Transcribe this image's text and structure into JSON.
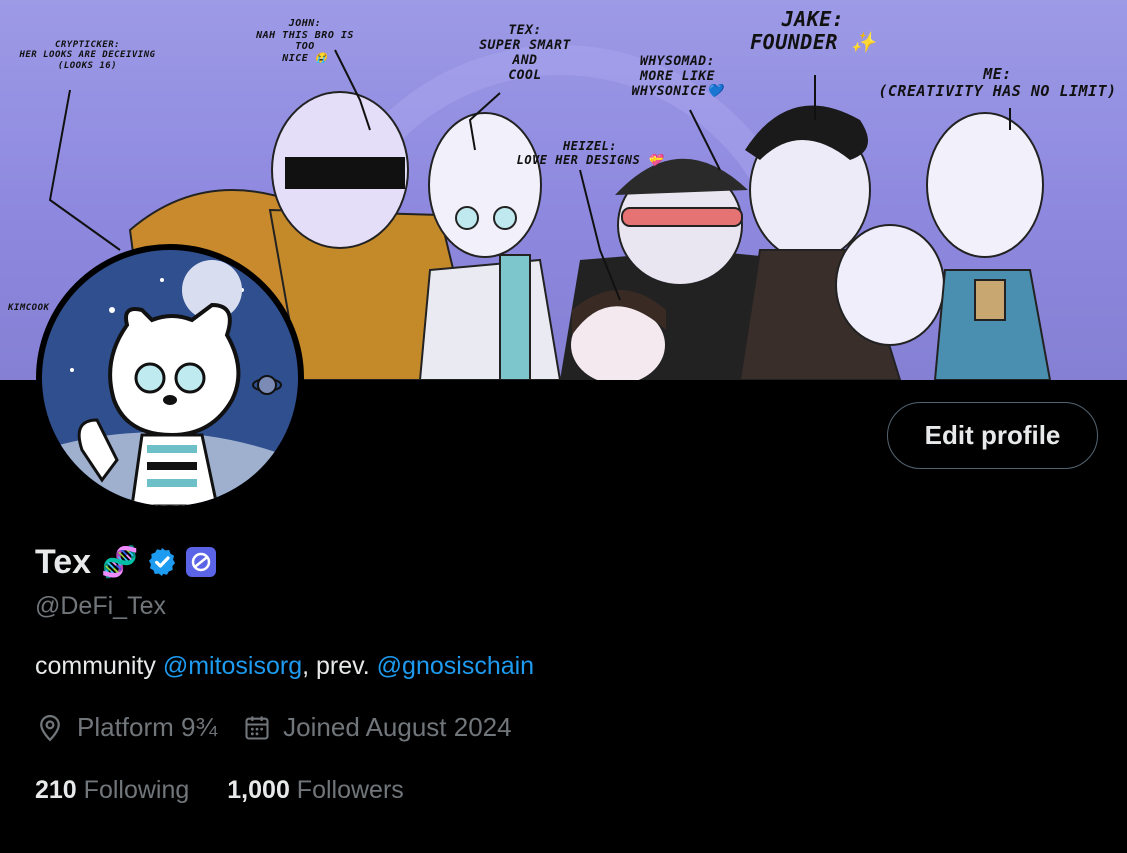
{
  "banner": {
    "captions": {
      "john": "JOHN:\nNAH THIS BRO IS TOO\nNICE 😭",
      "crypticker": "CRYPTICKER:\nHER LOOKS ARE DECEIVING\n(LOOKS 16)",
      "tex": "TEX:\nSUPER SMART\nAND\nCOOL",
      "whysomad": "WHYSOMAD:\nMORE LIKE\nWHYSONICE💙",
      "jake": "JAKE:\nFOUNDER ✨",
      "me": "ME:\n(CREATIVITY HAS NO LIMIT)",
      "heizel": "HEIZEL:\nLOVE HER DESIGNS 💝",
      "kimcook": "KIMCOOK"
    },
    "colors": {
      "sky": "#9d9ae6",
      "ink": "#111111"
    }
  },
  "profile": {
    "name": "Tex",
    "name_emoji": "🧬",
    "handle": "@DeFi_Tex",
    "bio_prefix": "community ",
    "bio_mention_1": "@mitosisorg",
    "bio_middle": ", prev. ",
    "bio_mention_2": "@gnosischain",
    "location": "Platform 9¾",
    "joined": "Joined August 2024",
    "following_count": "210",
    "following_label": "Following",
    "followers_count": "1,000",
    "followers_label": "Followers",
    "edit_button": "Edit profile",
    "icons": [
      "dna-emoji",
      "verified-badge-icon",
      "affiliate-badge-icon",
      "location-pin-icon",
      "calendar-icon"
    ]
  },
  "colors": {
    "background": "#000000",
    "text": "#e7e9ea",
    "muted": "#71767b",
    "accent": "#1d9bf0"
  }
}
